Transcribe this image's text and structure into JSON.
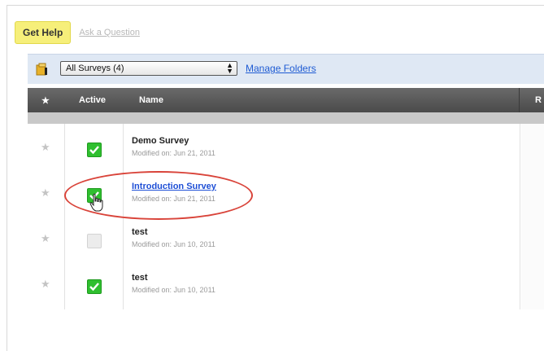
{
  "help": {
    "get_help": "Get Help",
    "ask": "Ask a Question"
  },
  "toolbar": {
    "folder_select": "All Surveys (4)",
    "manage": "Manage Folders"
  },
  "table": {
    "headers": {
      "star": "★",
      "active": "Active",
      "name": "Name",
      "extra": "R"
    },
    "rows": [
      {
        "name": "Demo Survey",
        "modified": "Modified on: Jun 21, 2011",
        "active": true
      },
      {
        "name": "Introduction Survey",
        "modified": "Modified on: Jun 21, 2011",
        "active": true,
        "highlighted": true
      },
      {
        "name": "test",
        "modified": "Modified on: Jun 10, 2011",
        "active": false
      },
      {
        "name": "test",
        "modified": "Modified on: Jun 10, 2011",
        "active": true
      }
    ]
  },
  "colors": {
    "accent_link": "#1e4fd6",
    "check_green": "#2fbf2f",
    "highlight_circle": "#d9443a",
    "help_yellow": "#f6ef7a"
  },
  "icons": [
    "folder-icon",
    "star-icon",
    "checkbox-checked-icon",
    "checkbox-unchecked-icon",
    "hand-cursor-icon"
  ]
}
